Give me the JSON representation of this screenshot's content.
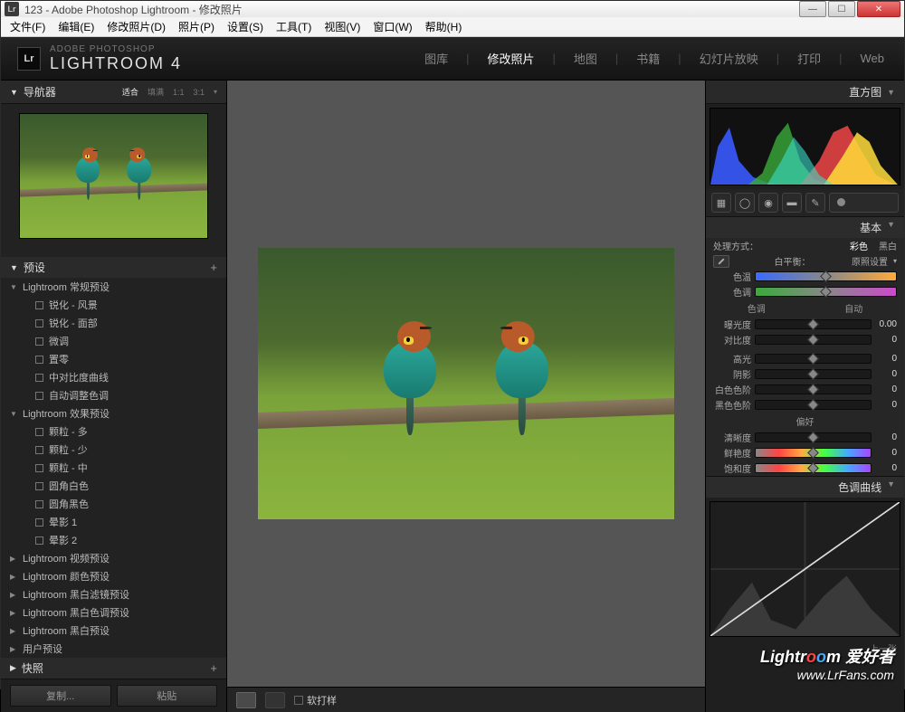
{
  "window": {
    "title": "123 - Adobe Photoshop Lightroom - 修改照片"
  },
  "menus": [
    "文件(F)",
    "编辑(E)",
    "修改照片(D)",
    "照片(P)",
    "设置(S)",
    "工具(T)",
    "视图(V)",
    "窗口(W)",
    "帮助(H)"
  ],
  "branding": {
    "small": "ADOBE PHOTOSHOP",
    "big": "LIGHTROOM 4"
  },
  "modules": [
    {
      "label": "图库",
      "active": false
    },
    {
      "label": "修改照片",
      "active": true
    },
    {
      "label": "地图",
      "active": false
    },
    {
      "label": "书籍",
      "active": false
    },
    {
      "label": "幻灯片放映",
      "active": false
    },
    {
      "label": "打印",
      "active": false
    },
    {
      "label": "Web",
      "active": false
    }
  ],
  "navigator": {
    "title": "导航器",
    "fit": "适合",
    "fill": "填满",
    "z1": "1:1",
    "z2": "3:1"
  },
  "presets": {
    "title": "预设",
    "groups": [
      {
        "label": "Lightroom 常规预设",
        "expanded": true,
        "items": [
          "锐化 - 风景",
          "锐化 - 面部",
          "微调",
          "置零",
          "中对比度曲线",
          "自动调整色调"
        ]
      },
      {
        "label": "Lightroom 效果预设",
        "expanded": true,
        "items": [
          "颗粒 - 多",
          "颗粒 - 少",
          "颗粒 - 中",
          "圆角白色",
          "圆角黑色",
          "晕影 1",
          "晕影 2"
        ]
      },
      {
        "label": "Lightroom 视频预设",
        "expanded": false
      },
      {
        "label": "Lightroom 颜色预设",
        "expanded": false
      },
      {
        "label": "Lightroom 黑白滤镜预设",
        "expanded": false
      },
      {
        "label": "Lightroom 黑白色调预设",
        "expanded": false
      },
      {
        "label": "Lightroom 黑白预设",
        "expanded": false
      },
      {
        "label": "用户预设",
        "expanded": false
      }
    ]
  },
  "snapshots": {
    "title": "快照"
  },
  "buttons": {
    "copy": "复制...",
    "paste": "粘贴"
  },
  "softproof": "软打样",
  "rightPanels": {
    "histogram": "直方图",
    "basic": {
      "title": "基本",
      "treatment": "处理方式：",
      "color": "彩色",
      "bw": "黑白",
      "wb": "白平衡：",
      "wbval": "原照设置",
      "temp": "色温",
      "tint": "色调",
      "tone": "色调",
      "auto": "自动",
      "exposure": "曝光度",
      "contrast": "对比度",
      "highlights": "高光",
      "shadows": "阴影",
      "whites": "白色色阶",
      "blacks": "黑色色阶",
      "presence": "偏好",
      "clarity": "清晰度",
      "vibrance": "鲜艳度",
      "saturation": "饱和度",
      "zero": "0",
      "expzero": "0.00"
    },
    "tonecurve": "色调曲线",
    "prev": "上一张"
  },
  "watermark": {
    "line1a": "Lightr",
    "line1b": "m 爱好者",
    "line2": "www.LrFans.com"
  }
}
